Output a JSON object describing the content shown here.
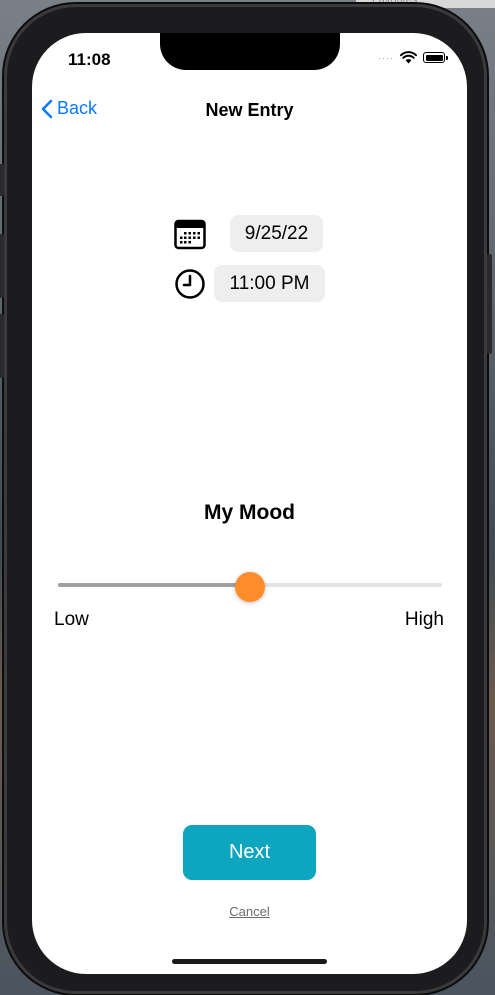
{
  "desktop": {
    "label": "Favorites"
  },
  "status_bar": {
    "time": "11:08"
  },
  "nav": {
    "back_label": "Back",
    "title": "New Entry"
  },
  "entry": {
    "date": "9/25/22",
    "time": "11:00 PM"
  },
  "mood": {
    "title": "My Mood",
    "low_label": "Low",
    "high_label": "High",
    "value": 0.5,
    "thumb_color": "#ff8c2a"
  },
  "actions": {
    "next_label": "Next",
    "cancel_label": "Cancel"
  },
  "colors": {
    "accent": "#0a7aff",
    "button": "#0ea5be"
  }
}
